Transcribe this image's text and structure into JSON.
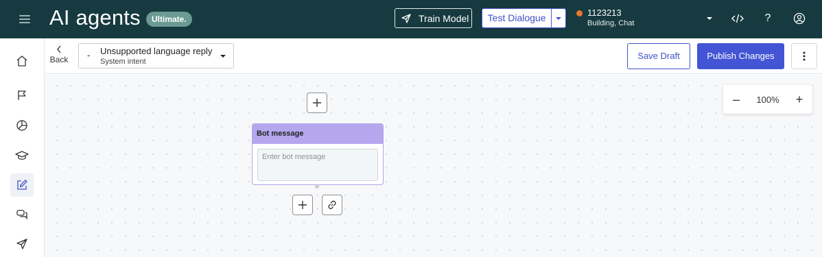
{
  "header": {
    "app_title": "AI agents",
    "badge": "Ultimate.",
    "train_model": "Train Model",
    "test_dialogue": "Test Dialogue",
    "project_id": "1123213",
    "project_sub": "Building, Chat",
    "status_color": "#e8772e"
  },
  "toolbar": {
    "back": "Back",
    "intent_prefix": "-",
    "intent_name": "Unsupported language reply",
    "intent_type": "System intent",
    "save_draft": "Save Draft",
    "publish": "Publish Changes"
  },
  "canvas": {
    "zoom_minus": "–",
    "zoom_value": "100%",
    "zoom_plus": "+",
    "bot_message_title": "Bot message",
    "bot_message_placeholder": "Enter bot message"
  },
  "nav": {
    "items": [
      "home-icon",
      "flag-icon",
      "pie-chart-icon",
      "graduation-cap-icon",
      "edit-icon",
      "chat-icon",
      "send-icon"
    ],
    "active": "edit-icon"
  },
  "colors": {
    "topbar": "#163a3f",
    "primary": "#4355d4",
    "card_header": "#b4a7ee"
  }
}
